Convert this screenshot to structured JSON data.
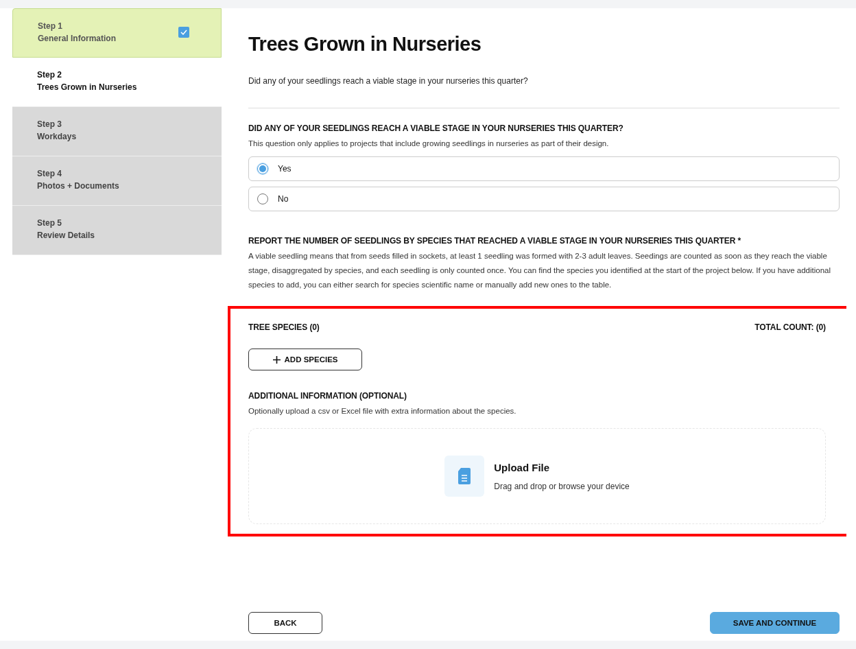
{
  "sidebar": {
    "steps": [
      {
        "step": "Step 1",
        "title": "General Information",
        "kind": "completed",
        "checked": true
      },
      {
        "step": "Step 2",
        "title": "Trees Grown in Nurseries",
        "kind": "current",
        "checked": false
      },
      {
        "step": "Step 3",
        "title": "Workdays",
        "kind": "upcoming",
        "checked": false
      },
      {
        "step": "Step 4",
        "title": "Photos + Documents",
        "kind": "upcoming",
        "checked": false
      },
      {
        "step": "Step 5",
        "title": "Review Details",
        "kind": "upcoming",
        "checked": false
      }
    ]
  },
  "page": {
    "title": "Trees Grown in Nurseries",
    "subtitle": "Did any of your seedlings reach a viable stage in your nurseries this quarter?"
  },
  "question": {
    "heading": "DID ANY OF YOUR SEEDLINGS REACH A VIABLE STAGE IN YOUR NURSERIES THIS QUARTER?",
    "description": "This question only applies to projects that include growing seedlings in nurseries as part of their design.",
    "options": [
      {
        "label": "Yes",
        "selected": true
      },
      {
        "label": "No",
        "selected": false
      }
    ]
  },
  "report": {
    "heading": "REPORT THE NUMBER OF SEEDLINGS BY SPECIES THAT REACHED A VIABLE STAGE IN YOUR NURSERIES THIS QUARTER *",
    "description": "A viable seedling means that from seeds filled in sockets, at least 1 seedling was formed with 2-3 adult leaves. Seedings are counted as soon as they reach the viable stage, disaggregated by species, and each seedling is only counted once. You can find the species you identified at the start of the project below. If you have additional species to add, you can either search for species scientific name or manually add new ones to the table."
  },
  "species": {
    "label": "TREE SPECIES (0)",
    "total": "TOTAL COUNT: (0)",
    "add_button": "ADD SPECIES"
  },
  "additional": {
    "heading": "ADDITIONAL INFORMATION (OPTIONAL)",
    "description": "Optionally upload a csv or Excel file with extra information about the species.",
    "upload_title": "Upload File",
    "upload_hint": "Drag and drop or browse your device"
  },
  "buttons": {
    "back": "BACK",
    "save": "SAVE AND CONTINUE"
  }
}
